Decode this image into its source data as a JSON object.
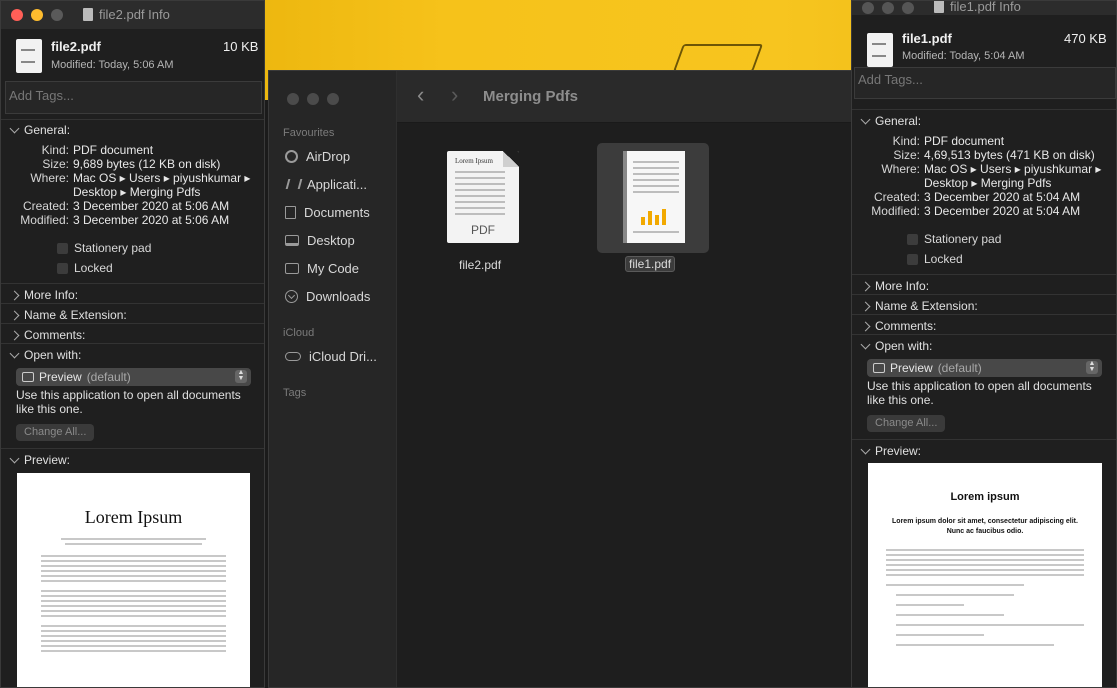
{
  "finder": {
    "title": "Merging Pdfs",
    "sidebar": {
      "favourites_label": "Favourites",
      "items": [
        {
          "label": "AirDrop",
          "icon": "airdrop-icon"
        },
        {
          "label": "Applicati...",
          "icon": "applications-icon"
        },
        {
          "label": "Documents",
          "icon": "document-icon"
        },
        {
          "label": "Desktop",
          "icon": "desktop-icon"
        },
        {
          "label": "My Code",
          "icon": "folder-icon"
        },
        {
          "label": "Downloads",
          "icon": "downloads-icon"
        }
      ],
      "icloud_label": "iCloud",
      "icloud_item": "iCloud Dri...",
      "tags_label": "Tags"
    },
    "files": [
      {
        "name": "file2.pdf",
        "thumb_title": "Lorem Ipsum",
        "thumb_tag": "PDF"
      },
      {
        "name": "file1.pdf",
        "selected": true
      }
    ]
  },
  "info_left": {
    "window_title": "file2.pdf Info",
    "name": "file2.pdf",
    "size": "10 KB",
    "modified": "Modified: Today, 5:06 AM",
    "tags_placeholder": "Add Tags...",
    "general_label": "General:",
    "general": {
      "kind_k": "Kind:",
      "kind": "PDF document",
      "size_k": "Size:",
      "size": "9,689 bytes (12 KB on disk)",
      "where_k": "Where:",
      "where1": "Mac OS ▸ Users ▸ piyushkumar ▸",
      "where2": "Desktop ▸ Merging Pdfs",
      "created_k": "Created:",
      "created": "3 December 2020 at 5:06 AM",
      "modified_k": "Modified:",
      "modified": "3 December 2020 at 5:06 AM"
    },
    "stationery": "Stationery pad",
    "locked": "Locked",
    "more_info": "More Info:",
    "name_ext": "Name & Extension:",
    "comments": "Comments:",
    "open_with": "Open with:",
    "app": "Preview",
    "app_default": "(default)",
    "use_app_1": "Use this application to open all documents",
    "use_app_2": "like this one.",
    "change_all": "Change All...",
    "preview_label": "Preview:",
    "preview_title": "Lorem Ipsum"
  },
  "info_right": {
    "window_title": "file1.pdf Info",
    "name": "file1.pdf",
    "size": "470 KB",
    "modified": "Modified: Today, 5:04 AM",
    "tags_placeholder": "Add Tags...",
    "general_label": "General:",
    "general": {
      "kind_k": "Kind:",
      "kind": "PDF document",
      "size_k": "Size:",
      "size": "4,69,513 bytes (471 KB on disk)",
      "where_k": "Where:",
      "where1": "Mac OS ▸ Users ▸ piyushkumar ▸",
      "where2": "Desktop ▸ Merging Pdfs",
      "created_k": "Created:",
      "created": "3 December 2020 at 5:04 AM",
      "modified_k": "Modified:",
      "modified": "3 December 2020 at 5:04 AM"
    },
    "stationery": "Stationery pad",
    "locked": "Locked",
    "more_info": "More Info:",
    "name_ext": "Name & Extension:",
    "comments": "Comments:",
    "open_with": "Open with:",
    "app": "Preview",
    "app_default": "(default)",
    "use_app_1": "Use this application to open all documents",
    "use_app_2": "like this one.",
    "change_all": "Change All...",
    "preview_label": "Preview:",
    "preview_title": "Lorem ipsum",
    "preview_sub": "Lorem ipsum dolor sit amet, consectetur adipiscing elit. Nunc ac faucibus odio."
  },
  "colors": {
    "wallpaper": "#f6c21a",
    "window_bg": "#1f1f1f",
    "selection": "#3c3c3c"
  }
}
